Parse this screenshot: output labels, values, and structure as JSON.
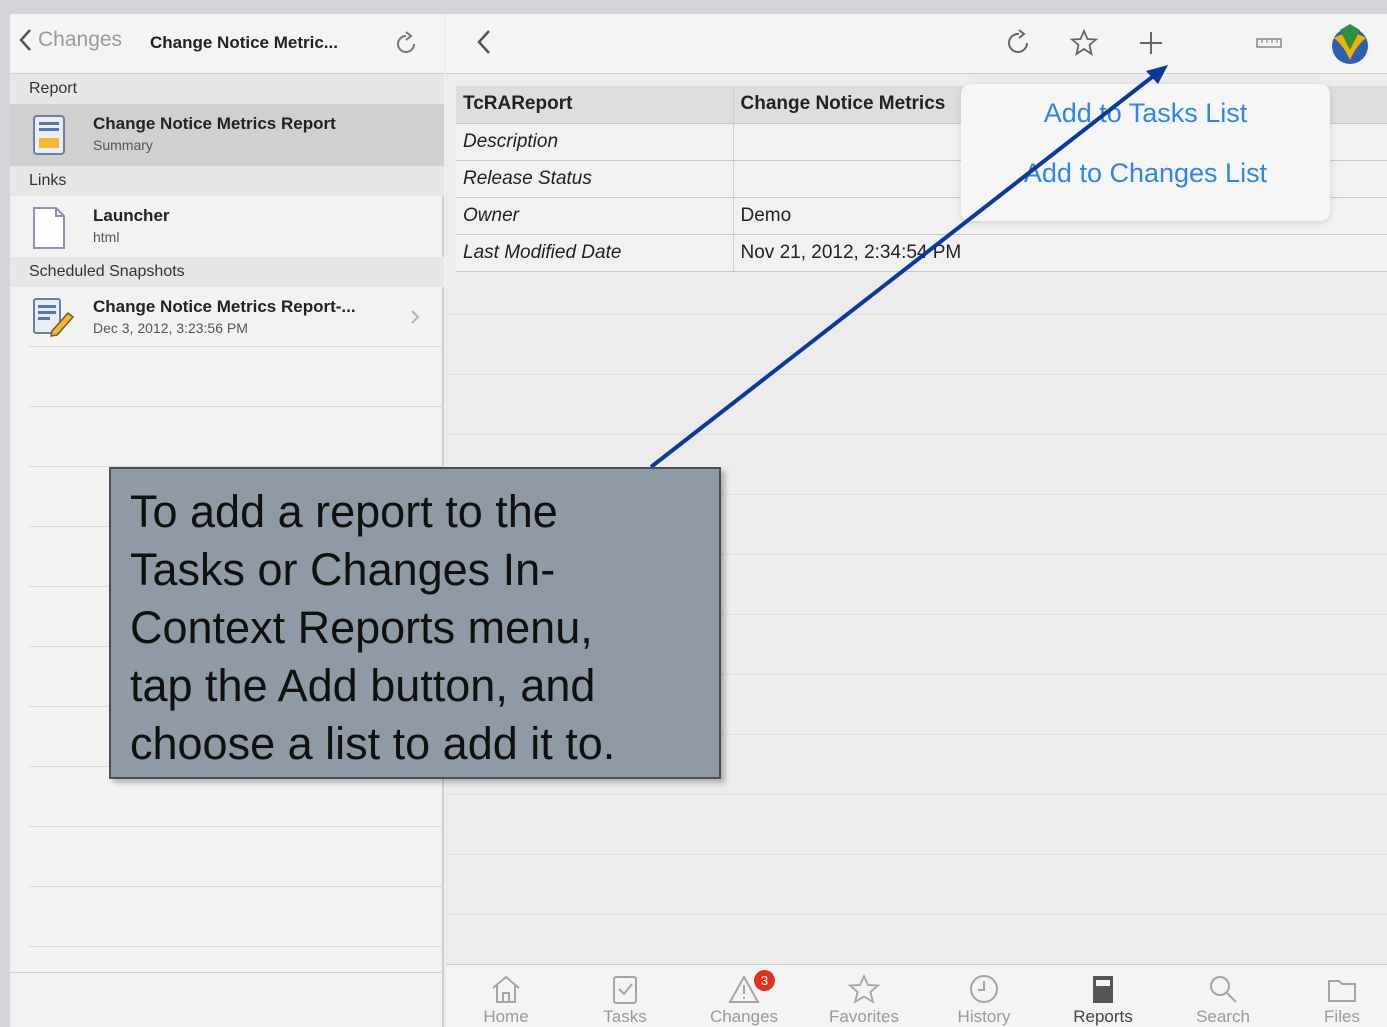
{
  "left_nav": {
    "back_label": "Changes",
    "title": "Change Notice Metric..."
  },
  "sections": {
    "report": "Report",
    "links": "Links",
    "snapshots": "Scheduled Snapshots"
  },
  "report_item": {
    "title": "Change Notice Metrics Report",
    "subtitle": "Summary"
  },
  "link_item": {
    "title": "Launcher",
    "subtitle": "html"
  },
  "snapshot_item": {
    "title": "Change Notice Metrics Report-...",
    "subtitle": "Dec 3, 2012, 3:23:56 PM"
  },
  "properties": {
    "header_key": "TcRAReport",
    "header_value": "Change Notice Metrics",
    "rows": [
      {
        "key": "Description",
        "value": ""
      },
      {
        "key": "Release Status",
        "value": ""
      },
      {
        "key": "Owner",
        "value": "Demo"
      },
      {
        "key": "Last Modified Date",
        "value": "Nov 21, 2012, 2:34:54 PM"
      }
    ]
  },
  "popover": {
    "add_tasks": "Add to Tasks List",
    "add_changes": "Add to Changes List"
  },
  "tabbar": {
    "items": [
      "Home",
      "Tasks",
      "Changes",
      "Favorites",
      "History",
      "Reports",
      "Search",
      "Files"
    ],
    "active": "Reports",
    "changes_badge": "3"
  },
  "callout": {
    "lines": [
      "To add a report to the",
      "Tasks or Changes In-",
      "Context Reports menu,",
      "tap the Add button, and",
      "choose a list to add it to."
    ]
  },
  "colors": {
    "accent_blue": "#2f86e6",
    "callout_bg": "#8f9aa6",
    "arrow": "#0a3a9c",
    "badge": "#e0301e"
  }
}
